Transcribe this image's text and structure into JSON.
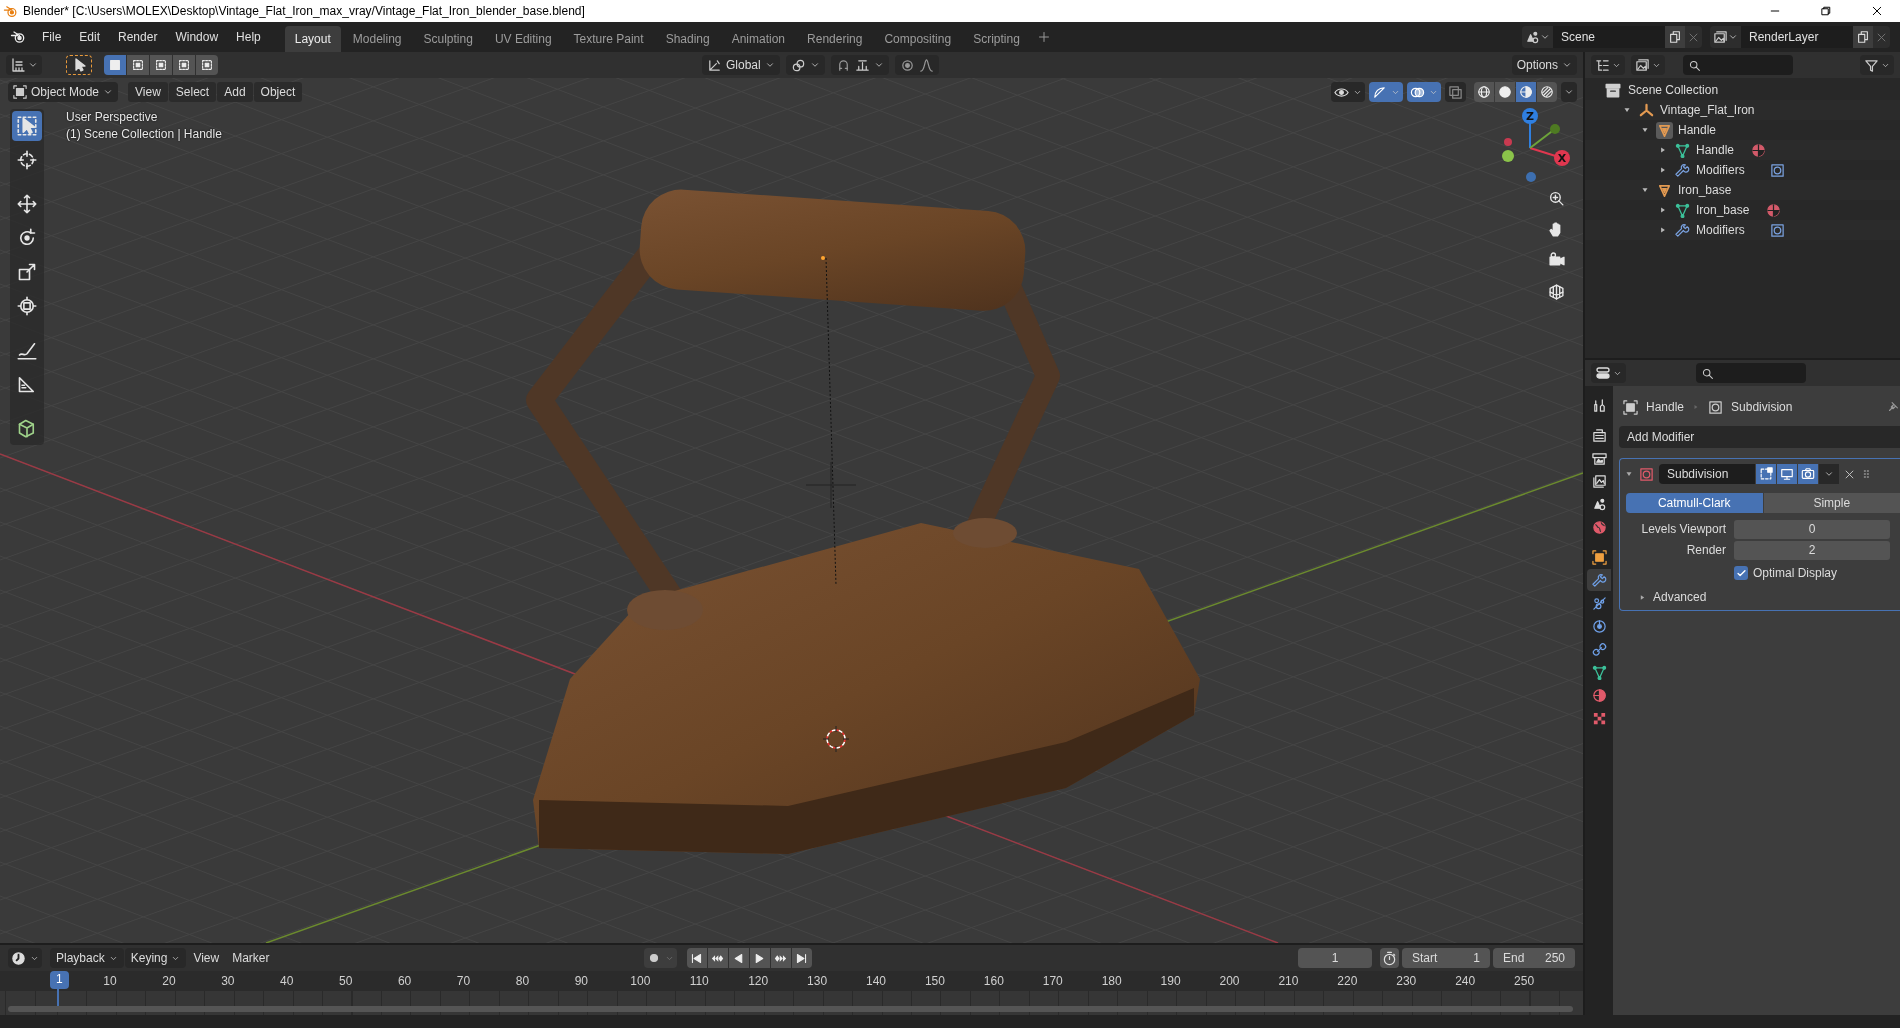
{
  "window": {
    "title": "Blender* [C:\\Users\\MOLEX\\Desktop\\Vintage_Flat_Iron_max_vray/Vintage_Flat_Iron_blender_base.blend]"
  },
  "menu": [
    "File",
    "Edit",
    "Render",
    "Window",
    "Help"
  ],
  "workspaces": [
    {
      "label": "Layout",
      "selected": true
    },
    {
      "label": "Modeling",
      "selected": false
    },
    {
      "label": "Sculpting",
      "selected": false
    },
    {
      "label": "UV Editing",
      "selected": false
    },
    {
      "label": "Texture Paint",
      "selected": false
    },
    {
      "label": "Shading",
      "selected": false
    },
    {
      "label": "Animation",
      "selected": false
    },
    {
      "label": "Rendering",
      "selected": false
    },
    {
      "label": "Compositing",
      "selected": false
    },
    {
      "label": "Scripting",
      "selected": false
    }
  ],
  "scene": {
    "name": "Scene"
  },
  "view_layer": {
    "name": "RenderLayer"
  },
  "viewport": {
    "select_modes": [
      {
        "kind": "set",
        "selected": true
      },
      {
        "kind": "extend",
        "selected": false
      },
      {
        "kind": "subtract",
        "selected": false
      },
      {
        "kind": "invert",
        "selected": false
      },
      {
        "kind": "intersect",
        "selected": false
      }
    ],
    "transform_orientation": "Global",
    "options": "Options",
    "mode": "Object Mode",
    "menus": [
      "View",
      "Select",
      "Add",
      "Object"
    ],
    "info": [
      "User Perspective",
      "(1) Scene Collection | Handle"
    ],
    "tools": [
      {
        "kind": "select",
        "selected": true
      },
      {
        "kind": "cursor",
        "selected": false
      },
      {
        "kind": "move",
        "selected": false
      },
      {
        "kind": "rotate",
        "selected": false
      },
      {
        "kind": "scale",
        "selected": false
      },
      {
        "kind": "transform",
        "selected": false
      },
      {
        "kind": "annotate",
        "selected": false
      },
      {
        "kind": "measure",
        "selected": false
      },
      {
        "kind": "add-cube",
        "selected": false
      }
    ],
    "shading": [
      {
        "kind": "wireframe",
        "selected": false
      },
      {
        "kind": "solid",
        "selected": false
      },
      {
        "kind": "material",
        "selected": true
      },
      {
        "kind": "rendered",
        "selected": false
      }
    ],
    "gizmo_axes": [
      {
        "label": "Z",
        "color": "#2f7fe0"
      },
      {
        "label": "X",
        "color": "#e0374f"
      }
    ]
  },
  "outliner": {
    "tree": {
      "label": "Scene Collection",
      "kind": "scene-collection",
      "children": [
        {
          "label": "Vintage_Flat_Iron",
          "kind": "empty",
          "expanded": true,
          "active": false,
          "children": [
            {
              "label": "Handle",
              "kind": "object",
              "expanded": true,
              "active": true,
              "children": [
                {
                  "label": "Handle",
                  "kind": "mesh",
                  "expanded": false,
                  "active": false
                },
                {
                  "label": "Modifiers",
                  "kind": "modifiers",
                  "expanded": false,
                  "active": false
                }
              ]
            },
            {
              "label": "Iron_base",
              "kind": "object",
              "expanded": true,
              "active": false,
              "children": [
                {
                  "label": "Iron_base",
                  "kind": "mesh",
                  "expanded": false,
                  "active": false
                },
                {
                  "label": "Modifiers",
                  "kind": "modifiers",
                  "expanded": false,
                  "active": false
                }
              ]
            }
          ]
        }
      ]
    }
  },
  "properties": {
    "tabs": [
      {
        "kind": "tool",
        "selected": false
      },
      {
        "kind": "render",
        "selected": false
      },
      {
        "kind": "output",
        "selected": false
      },
      {
        "kind": "view-layer",
        "selected": false
      },
      {
        "kind": "scene",
        "selected": false
      },
      {
        "kind": "world",
        "selected": false
      },
      {
        "kind": "object",
        "selected": false
      },
      {
        "kind": "modifiers",
        "selected": true
      },
      {
        "kind": "particles",
        "selected": false
      },
      {
        "kind": "physics",
        "selected": false
      },
      {
        "kind": "constraints",
        "selected": false
      },
      {
        "kind": "data",
        "selected": false
      },
      {
        "kind": "material",
        "selected": false
      },
      {
        "kind": "texture",
        "selected": false
      }
    ],
    "breadcrumb": [
      "Handle",
      "Subdivision"
    ],
    "add_modifier": "Add Modifier",
    "modifier": {
      "name": "Subdivision",
      "expanded": true,
      "toggles": [
        {
          "kind": "edit-mode",
          "on": true
        },
        {
          "kind": "viewport",
          "on": true
        },
        {
          "kind": "render",
          "on": true
        }
      ],
      "algorithms": [
        {
          "label": "Catmull-Clark",
          "selected": true
        },
        {
          "label": "Simple",
          "selected": false
        }
      ],
      "fields": [
        {
          "label": "Levels Viewport",
          "value": "0"
        },
        {
          "label": "Render",
          "value": "2"
        }
      ],
      "checkbox": {
        "label": "Optimal Display",
        "checked": true
      },
      "subpanel": {
        "label": "Advanced",
        "expanded": false
      }
    }
  },
  "timeline": {
    "menus": [
      {
        "label": "Playback",
        "dropdown": true
      },
      {
        "label": "Keying",
        "dropdown": true
      },
      {
        "label": "View",
        "dropdown": false
      },
      {
        "label": "Marker",
        "dropdown": false
      }
    ],
    "auto_keying": false,
    "current_frame": "1",
    "start": {
      "label": "Start",
      "value": "1"
    },
    "end": {
      "label": "End",
      "value": "250"
    },
    "playhead": "1",
    "ruler": [
      "10",
      "20",
      "30",
      "40",
      "50",
      "60",
      "70",
      "80",
      "90",
      "100",
      "110",
      "120",
      "130",
      "140",
      "150",
      "160",
      "170",
      "180",
      "190",
      "200",
      "210",
      "220",
      "230",
      "240",
      "250"
    ]
  }
}
